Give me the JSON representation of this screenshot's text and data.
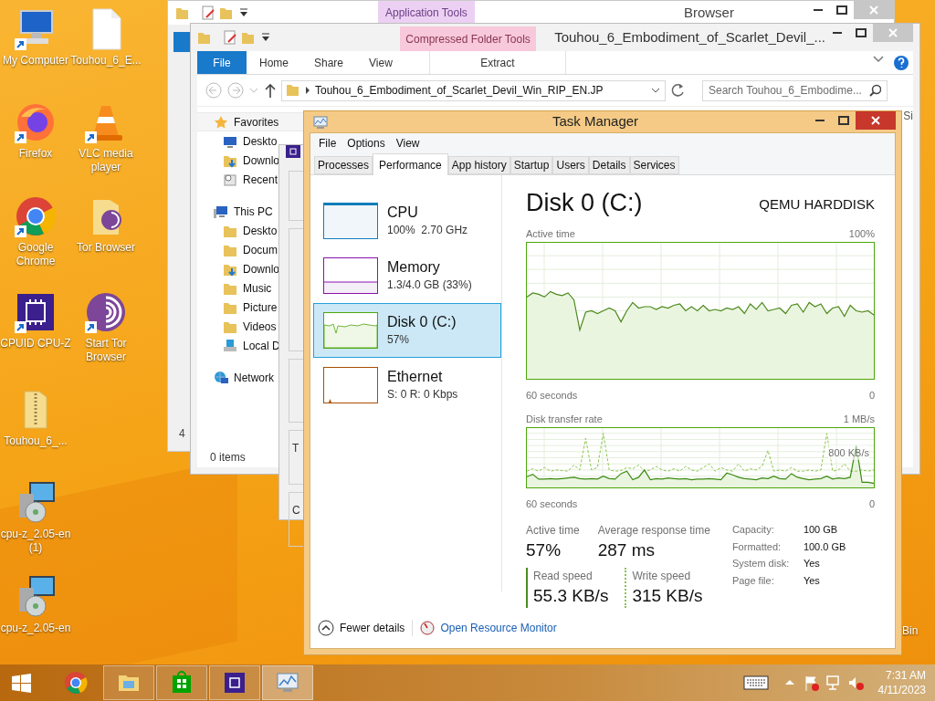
{
  "desktop_icons": [
    {
      "label": "My Computer",
      "kind": "computer",
      "shortcut": true
    },
    {
      "label": "Touhou_6_E...",
      "kind": "document",
      "shortcut": false
    },
    {
      "label": "Firefox",
      "kind": "firefox",
      "shortcut": true
    },
    {
      "label": "VLC media player",
      "kind": "vlc",
      "shortcut": true
    },
    {
      "label": "Google Chrome",
      "kind": "chrome",
      "shortcut": true
    },
    {
      "label": "Tor Browser",
      "kind": "tor_folder",
      "shortcut": false
    },
    {
      "label": "CPUID CPU-Z",
      "kind": "cpuz",
      "shortcut": true
    },
    {
      "label": "Start Tor Browser",
      "kind": "tor",
      "shortcut": true
    },
    {
      "label": "Touhou_6_...",
      "kind": "zip_folder",
      "shortcut": false
    },
    {
      "label": "cpu-z_2.05-en (1)",
      "kind": "installer",
      "shortcut": false
    },
    {
      "label": "cpu-z_2.05-en",
      "kind": "installer",
      "shortcut": false
    }
  ],
  "desktop_edge_label": "Bin",
  "browser_window": {
    "title": "Browser",
    "context_tab": "Application Tools",
    "status": "4"
  },
  "folder_window": {
    "title": "Touhou_6_Embodiment_of_Scarlet_Devil_...",
    "context_tab": "Compressed Folder Tools",
    "ribbon_tabs": [
      {
        "label": "File",
        "kind": "file"
      },
      {
        "label": "Home",
        "kind": "tab"
      },
      {
        "label": "Share",
        "kind": "tab"
      },
      {
        "label": "View",
        "kind": "tab"
      },
      {
        "label": "Extract",
        "kind": "context"
      }
    ],
    "address": "Touhou_6_Embodiment_of_Scarlet_Devil_Win_RIP_EN.JP",
    "search": {
      "placeholder": "Search Touhou_6_Embodime..."
    },
    "nav_tree": [
      {
        "label": "Favorites",
        "kind": "star",
        "children": [
          {
            "label": "Deskto",
            "kind": "desktop"
          },
          {
            "label": "Downlo",
            "kind": "downloads"
          },
          {
            "label": "Recent",
            "kind": "recent"
          }
        ]
      },
      {
        "label": "This PC",
        "kind": "pc",
        "children": [
          {
            "label": "Deskto",
            "kind": "folder"
          },
          {
            "label": "Docum",
            "kind": "folder"
          },
          {
            "label": "Downlo",
            "kind": "downloads"
          },
          {
            "label": "Music",
            "kind": "folder"
          },
          {
            "label": "Picture",
            "kind": "folder"
          },
          {
            "label": "Videos",
            "kind": "folder"
          },
          {
            "label": "Local D",
            "kind": "drive"
          }
        ]
      },
      {
        "label": "Network",
        "kind": "network"
      }
    ],
    "column_1": "Si",
    "status": "0 items"
  },
  "third_window": {
    "partial_labels": [
      "T",
      "C"
    ]
  },
  "task_manager": {
    "title": "Task Manager",
    "menu": [
      "File",
      "Options",
      "View"
    ],
    "tabs": [
      {
        "label": "Processes",
        "selected": false
      },
      {
        "label": "Performance",
        "selected": true
      },
      {
        "label": "App history",
        "selected": false
      },
      {
        "label": "Startup",
        "selected": false
      },
      {
        "label": "Users",
        "selected": false
      },
      {
        "label": "Details",
        "selected": false
      },
      {
        "label": "Services",
        "selected": false
      }
    ],
    "resources": [
      {
        "name": "CPU",
        "detail": "100%  2.70 GHz",
        "color": "#117dbb",
        "selected": false
      },
      {
        "name": "Memory",
        "detail": "1.3/4.0 GB (33%)",
        "color": "#8b12ae",
        "selected": false
      },
      {
        "name": "Disk 0 (C:)",
        "detail": "57%",
        "color": "#4da60c",
        "selected": true
      },
      {
        "name": "Ethernet",
        "detail": "S: 0 R: 0 Kbps",
        "color": "#a74f01",
        "selected": false
      }
    ],
    "detail": {
      "title": "Disk 0 (C:)",
      "model": "QEMU HARDDISK",
      "graphs": [
        {
          "label": "Active time",
          "max": "100%",
          "time": "60 seconds",
          "min": "0"
        },
        {
          "label": "Disk transfer rate",
          "max": "1 MB/s",
          "mid": "800 KB/s",
          "time": "60 seconds",
          "min": "0"
        }
      ],
      "stats": [
        {
          "label": "Active time",
          "value": "57%"
        },
        {
          "label": "Average response time",
          "value": "287 ms"
        }
      ],
      "speeds": [
        {
          "label": "Read speed",
          "value": "55.3 KB/s",
          "kind": "read"
        },
        {
          "label": "Write speed",
          "value": "315 KB/s",
          "kind": "write"
        }
      ],
      "properties": [
        {
          "label": "Capacity:",
          "value": "100 GB"
        },
        {
          "label": "Formatted:",
          "value": "100.0 GB"
        },
        {
          "label": "System disk:",
          "value": "Yes"
        },
        {
          "label": "Page file:",
          "value": "Yes"
        }
      ]
    },
    "footer": {
      "toggle": "Fewer details",
      "link": "Open Resource Monitor"
    }
  },
  "taskbar": {
    "apps": [
      {
        "kind": "chrome",
        "running": false,
        "active": false
      },
      {
        "kind": "explorer",
        "running": true,
        "active": false
      },
      {
        "kind": "store",
        "running": true,
        "active": false
      },
      {
        "kind": "cpuz",
        "running": true,
        "active": false
      },
      {
        "kind": "taskmgr",
        "running": true,
        "active": true
      }
    ],
    "time": "7:31 AM",
    "date": "4/11/2023"
  }
}
